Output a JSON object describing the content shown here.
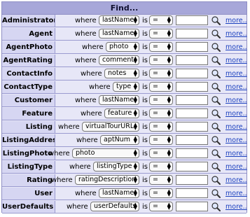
{
  "header": {
    "title": "Find..."
  },
  "labels": {
    "where": "where",
    "is": "is",
    "more": "more.."
  },
  "operator_value": "=",
  "rows": [
    {
      "entity": "Administrator",
      "field": "lastName",
      "selW": 58
    },
    {
      "entity": "Agent",
      "field": "lastName",
      "selW": 58
    },
    {
      "entity": "AgentPhoto",
      "field": "photo",
      "selW": 48
    },
    {
      "entity": "AgentRating",
      "field": "comment",
      "selW": 58
    },
    {
      "entity": "ContactInfo",
      "field": "notes",
      "selW": 50
    },
    {
      "entity": "ContactType",
      "field": "type",
      "selW": 38
    },
    {
      "entity": "Customer",
      "field": "lastName",
      "selW": 58
    },
    {
      "entity": "Feature",
      "field": "feature",
      "selW": 50
    },
    {
      "entity": "Listing",
      "field": "virtualTourURL",
      "selW": 82
    },
    {
      "entity": "ListingAddress",
      "field": "aptNum",
      "selW": 56
    },
    {
      "entity": "ListingPhoto",
      "field": "photo",
      "selW": 96
    },
    {
      "entity": "ListingType",
      "field": "listingType",
      "selW": 66
    },
    {
      "entity": "Rating",
      "field": "ratingDescription",
      "selW": 92
    },
    {
      "entity": "User",
      "field": "lastName",
      "selW": 58
    },
    {
      "entity": "UserDefaults",
      "field": "userDefaults",
      "selW": 70
    }
  ]
}
